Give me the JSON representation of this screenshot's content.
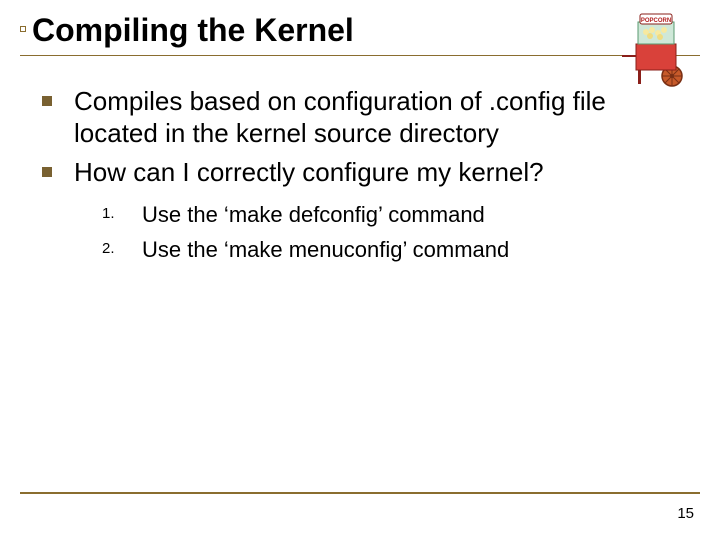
{
  "title": "Compiling the Kernel",
  "bullets": [
    "Compiles based on configuration of .config file located in the kernel source directory",
    "How can I correctly configure my kernel?"
  ],
  "sub": {
    "items": [
      {
        "num": "1.",
        "text": "Use the ‘make defconfig’ command"
      },
      {
        "num": "2.",
        "text": "Use the ‘make menuconfig’ command"
      }
    ]
  },
  "page_number": "15",
  "icon": {
    "name": "popcorn-cart"
  }
}
